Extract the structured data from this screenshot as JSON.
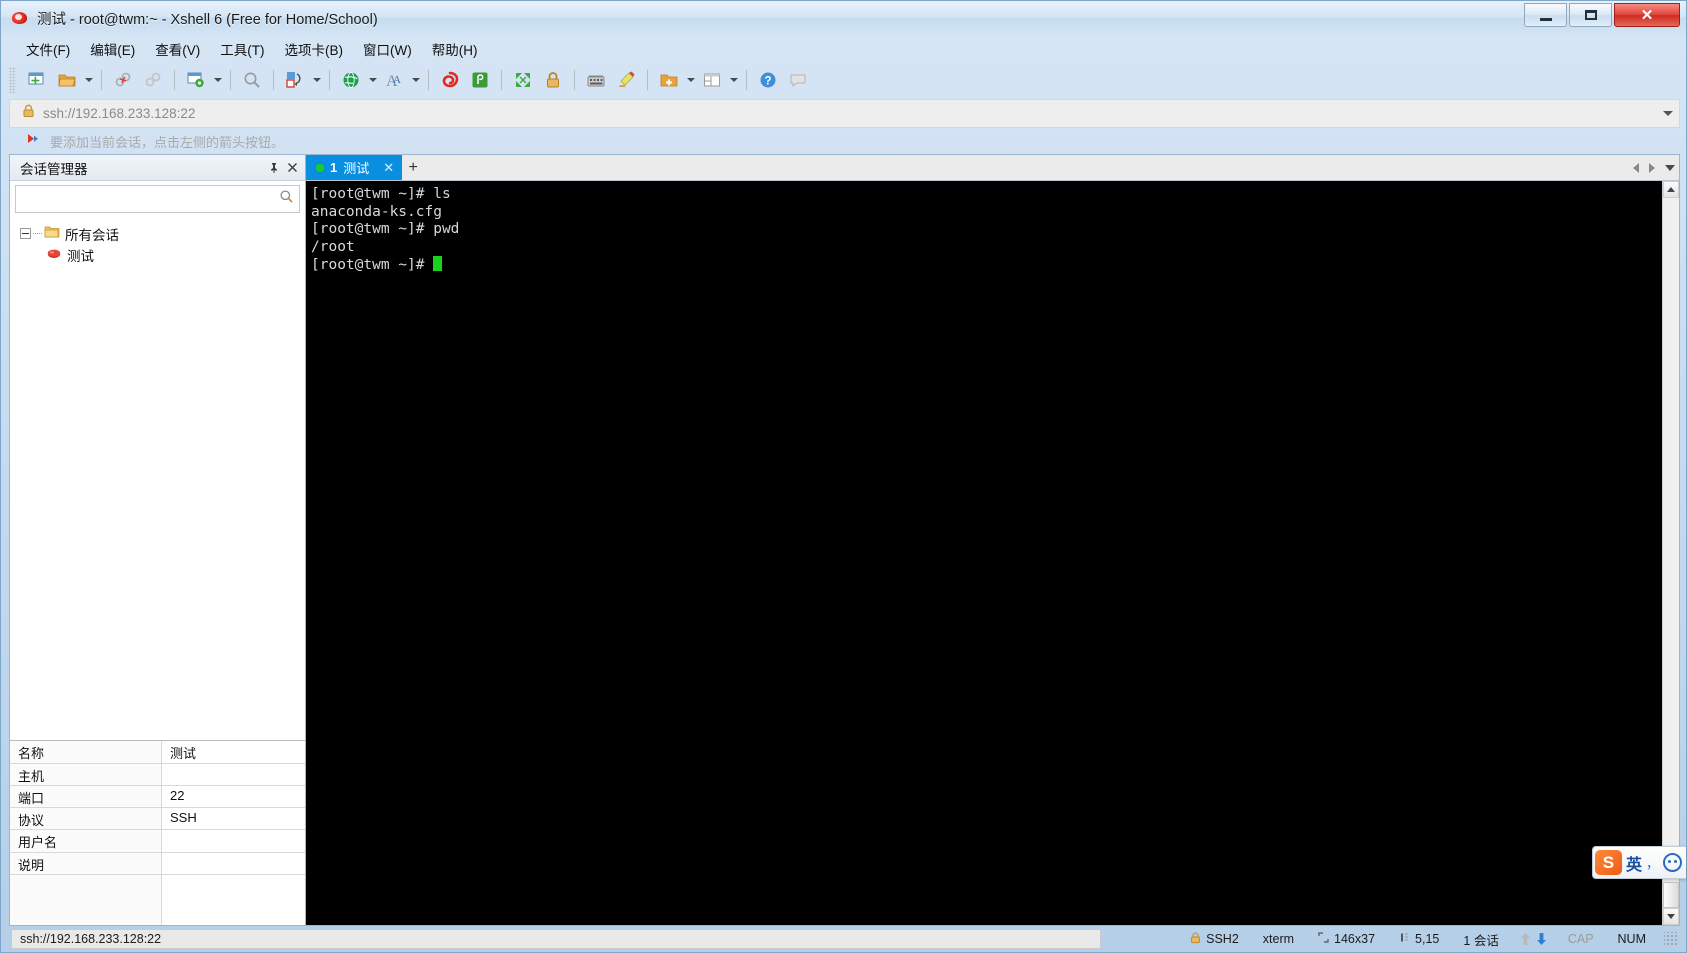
{
  "window": {
    "title": "测试 - root@twm:~ - Xshell 6 (Free for Home/School)",
    "minimize_label": "最小化",
    "maximize_label": "最大化",
    "close_label": "关闭"
  },
  "menu": [
    {
      "label": "文件(F)"
    },
    {
      "label": "编辑(E)"
    },
    {
      "label": "查看(V)"
    },
    {
      "label": "工具(T)"
    },
    {
      "label": "选项卡(B)"
    },
    {
      "label": "窗口(W)"
    },
    {
      "label": "帮助(H)"
    }
  ],
  "toolbar": [
    {
      "name": "new-session-icon",
      "tip": "新建会话",
      "caret": false
    },
    {
      "name": "open-session-icon",
      "tip": "打开会话",
      "caret": true
    },
    {
      "name": "disconnect-icon",
      "tip": "断开连接",
      "caret": false
    },
    {
      "name": "reconnect-icon",
      "tip": "重新连接",
      "caret": false
    },
    {
      "name": "session-properties-icon",
      "tip": "属性",
      "caret": true
    },
    {
      "name": "find-icon",
      "tip": "查找",
      "caret": false
    },
    {
      "name": "file-transfer-icon",
      "tip": "传输文件",
      "caret": true
    },
    {
      "name": "globe-icon",
      "tip": "浏览器",
      "caret": true
    },
    {
      "name": "font-icon",
      "tip": "字体",
      "caret": true
    },
    {
      "name": "xftp-icon",
      "tip": "Xftp",
      "caret": false
    },
    {
      "name": "xlpd-icon",
      "tip": "Xlpd",
      "caret": false
    },
    {
      "name": "fullscreen-icon",
      "tip": "全屏",
      "caret": false
    },
    {
      "name": "lock-icon",
      "tip": "锁定",
      "caret": false
    },
    {
      "name": "keyboard-icon",
      "tip": "撰写栏",
      "caret": false
    },
    {
      "name": "highlight-icon",
      "tip": "高亮集",
      "caret": false
    },
    {
      "name": "add-folder-icon",
      "tip": "新建文件夹",
      "caret": true
    },
    {
      "name": "layout-icon",
      "tip": "排列",
      "caret": true
    },
    {
      "name": "help-icon",
      "tip": "帮助",
      "caret": false
    },
    {
      "name": "chat-icon",
      "tip": "聊天",
      "caret": false
    }
  ],
  "address": {
    "value": "ssh://192.168.233.128:22",
    "lock_icon": "lock-icon",
    "dropdown_icon": "chevron-down-icon"
  },
  "hint": {
    "icon": "bookmark-icon",
    "text": "要添加当前会话，点击左侧的箭头按钮。"
  },
  "session_manager": {
    "title": "会话管理器",
    "pin_icon": "pin-icon",
    "close_icon": "close-icon",
    "search_placeholder": "",
    "search_value": "",
    "search_icon": "search-icon",
    "tree": {
      "root": {
        "label": "所有会话",
        "icon": "folder-icon",
        "expanded": true
      },
      "children": [
        {
          "label": "测试",
          "icon": "session-icon"
        }
      ]
    },
    "properties": [
      {
        "key": "名称",
        "value": "测试"
      },
      {
        "key": "主机",
        "value": ""
      },
      {
        "key": "端口",
        "value": "22"
      },
      {
        "key": "协议",
        "value": "SSH"
      },
      {
        "key": "用户名",
        "value": ""
      },
      {
        "key": "说明",
        "value": ""
      }
    ]
  },
  "tabs": {
    "items": [
      {
        "index": "1",
        "label": "测试",
        "active": true,
        "status_dot": "#19d219",
        "close_icon": "close-icon"
      }
    ],
    "add_label": "+",
    "nav_left_icon": "chevron-left-icon",
    "nav_right_icon": "chevron-right-icon",
    "nav_menu_icon": "chevron-down-icon"
  },
  "terminal": {
    "lines": [
      "[root@twm ~]# ls",
      "anaconda-ks.cfg",
      "[root@twm ~]# pwd",
      "/root"
    ],
    "prompt": "[root@twm ~]# ",
    "cursor_color": "#19d219",
    "background": "#000000",
    "foreground": "#d8d8d8"
  },
  "statusbar": {
    "connection": "ssh://192.168.233.128:22",
    "security_icon": "lock-icon",
    "protocol": "SSH2",
    "term_type": "xterm",
    "size_icon": "size-icon",
    "size": "146x37",
    "cursor_icon": "cursor-icon",
    "cursor_pos": "5,15",
    "sessions": "1 会话",
    "upload_icon": "arrow-up-icon",
    "download_icon": "arrow-down-icon",
    "caps": "CAP",
    "num": "NUM"
  },
  "ime": {
    "logo": "S",
    "lang": "英",
    "punct": "，",
    "menu_icon": "smiley-icon"
  },
  "colors": {
    "accent": "#0a8fe0",
    "title_gradient_top": "#e8f1fa",
    "terminal_bg": "#000000",
    "cursor_green": "#19d219",
    "ime_orange": "#ef5b12"
  }
}
